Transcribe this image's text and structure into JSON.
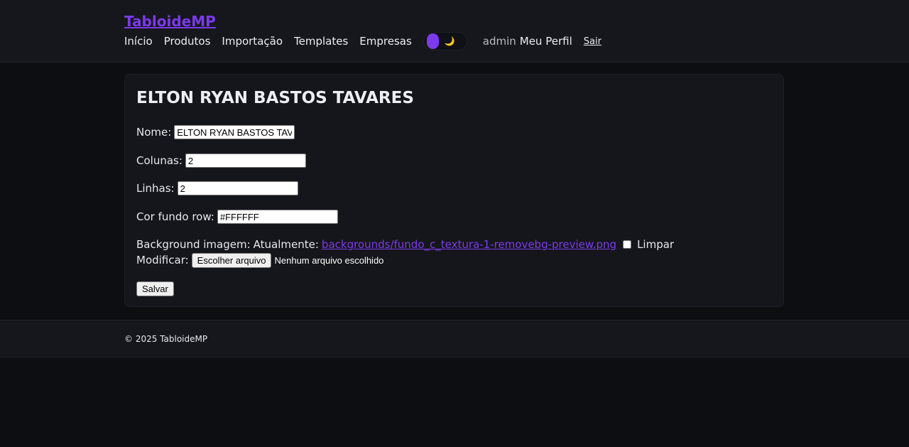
{
  "header": {
    "brand": "TabloideMP",
    "nav": [
      "Início",
      "Produtos",
      "Importação",
      "Templates",
      "Empresas"
    ],
    "theme_toggle_icon": "moon-icon",
    "user": "admin",
    "profile": "Meu Perfil",
    "logout": "Sair"
  },
  "form": {
    "title": "ELTON RYAN BASTOS TAVARES",
    "nome_label": "Nome:",
    "nome_value": "ELTON RYAN BASTOS TAVARES",
    "colunas_label": "Colunas:",
    "colunas_value": "2",
    "linhas_label": "Linhas:",
    "linhas_value": "2",
    "cor_label": "Cor fundo row:",
    "cor_value": "#FFFFFF",
    "bg_label": "Background imagem:",
    "currently_label": "Atualmente:",
    "current_file": "backgrounds/fundo_c_textura-1-removebg-preview.png",
    "clear_label": "Limpar",
    "modify_label": "Modificar:",
    "choose_file": "Escolher arquivo",
    "no_file": "Nenhum arquivo escolhido",
    "save": "Salvar"
  },
  "footer": {
    "text": "© 2025 TabloideMP"
  },
  "colors": {
    "accent": "#7c3aed",
    "background": "#0d0e12",
    "surface": "#15161b"
  }
}
